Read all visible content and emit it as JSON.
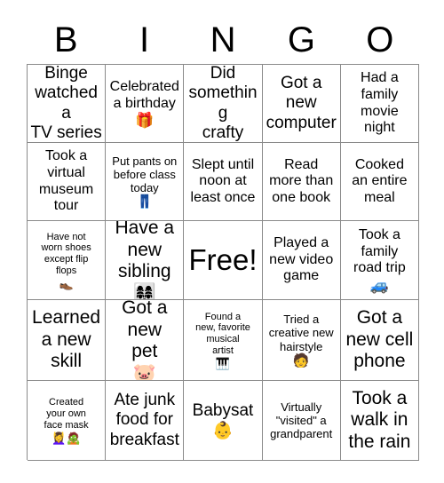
{
  "header": {
    "letters": [
      "B",
      "I",
      "N",
      "G",
      "O"
    ]
  },
  "grid": {
    "rows": 5,
    "columns": 5,
    "border_color": "#8a8a8a",
    "background_color": "#ffffff",
    "text_color": "#000000"
  },
  "cells": [
    {
      "text": "Binge\nwatched a\nTV series",
      "emoji": "",
      "emoji_name": "",
      "size": "fs-lg",
      "free": false
    },
    {
      "text": "Celebrated\na birthday",
      "emoji": "🎁",
      "emoji_name": "wrapped-gift-emoji",
      "size": "fs-md",
      "free": false
    },
    {
      "text": "Did\nsomething\ncrafty",
      "emoji": "",
      "emoji_name": "",
      "size": "fs-lg",
      "free": false
    },
    {
      "text": "Got a\nnew\ncomputer",
      "emoji": "",
      "emoji_name": "",
      "size": "fs-lg",
      "free": false
    },
    {
      "text": "Had a\nfamily\nmovie\nnight",
      "emoji": "",
      "emoji_name": "",
      "size": "fs-md",
      "free": false
    },
    {
      "text": "Took a\nvirtual\nmuseum\ntour",
      "emoji": "",
      "emoji_name": "",
      "size": "fs-md",
      "free": false
    },
    {
      "text": "Put pants on\nbefore class\ntoday",
      "emoji": "👖",
      "emoji_name": "jeans-emoji",
      "size": "fs-sm",
      "free": false
    },
    {
      "text": "Slept until\nnoon at\nleast once",
      "emoji": "",
      "emoji_name": "",
      "size": "fs-md",
      "free": false
    },
    {
      "text": "Read\nmore than\none book",
      "emoji": "",
      "emoji_name": "",
      "size": "fs-md",
      "free": false
    },
    {
      "text": "Cooked\nan entire\nmeal",
      "emoji": "",
      "emoji_name": "",
      "size": "fs-md",
      "free": false
    },
    {
      "text": "Have not\nworn shoes\nexcept flip\nflops",
      "emoji": "👞",
      "emoji_name": "mans-shoe-emoji",
      "size": "fs-xs",
      "free": false
    },
    {
      "text": "Have a\nnew\nsibling",
      "emoji": "👩‍👩‍👧‍👧",
      "emoji_name": "family-emoji",
      "size": "fs-xl",
      "free": false
    },
    {
      "text": "Free!",
      "emoji": "",
      "emoji_name": "",
      "size": "fs-free",
      "free": true
    },
    {
      "text": "Played a\nnew video\ngame",
      "emoji": "",
      "emoji_name": "",
      "size": "fs-md",
      "free": false
    },
    {
      "text": "Took a\nfamily\nroad trip",
      "emoji": "🚙",
      "emoji_name": "recreational-vehicle-emoji",
      "size": "fs-md",
      "free": false
    },
    {
      "text": "Learned\na new\nskill",
      "emoji": "",
      "emoji_name": "",
      "size": "fs-xl",
      "free": false
    },
    {
      "text": "Got a\nnew\npet",
      "emoji": "🐷",
      "emoji_name": "pig-face-emoji",
      "size": "fs-xl",
      "free": false
    },
    {
      "text": "Found a\nnew, favorite\nmusical\nartist",
      "emoji": "🎹",
      "emoji_name": "musical-keyboard-emoji",
      "size": "fs-xs",
      "free": false
    },
    {
      "text": "Tried a\ncreative new\nhairstyle",
      "emoji": "🧑",
      "emoji_name": "person-emoji",
      "size": "fs-sm",
      "free": false
    },
    {
      "text": "Got a\nnew cell\nphone",
      "emoji": "",
      "emoji_name": "",
      "size": "fs-xl",
      "free": false
    },
    {
      "text": "Created\nyour own\nface mask",
      "emoji": "💆‍♀️🧟",
      "emoji_name": "face-massage-and-zombie-emoji",
      "size": "fs-xs",
      "free": false
    },
    {
      "text": "Ate junk\nfood for\nbreakfast",
      "emoji": "",
      "emoji_name": "",
      "size": "fs-lg",
      "free": false
    },
    {
      "text": "Babysat",
      "emoji": "👶",
      "emoji_name": "baby-emoji",
      "size": "fs-lg",
      "free": false
    },
    {
      "text": "Virtually\n\"visited\" a\ngrandparent",
      "emoji": "",
      "emoji_name": "",
      "size": "fs-sm",
      "free": false
    },
    {
      "text": "Took a\nwalk in\nthe rain",
      "emoji": "",
      "emoji_name": "",
      "size": "fs-xl",
      "free": false
    }
  ]
}
